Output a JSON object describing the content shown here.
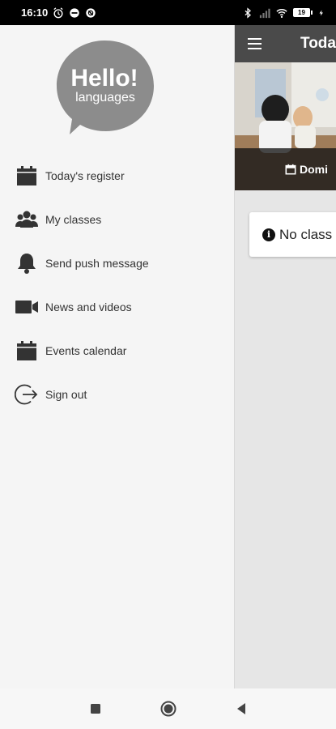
{
  "status_bar": {
    "time": "16:10",
    "battery": "19"
  },
  "drawer": {
    "logo": {
      "line1": "Hello!",
      "line2": "languages"
    },
    "items": [
      {
        "label": "Today's register",
        "icon": "calendar-icon"
      },
      {
        "label": "My classes",
        "icon": "people-icon"
      },
      {
        "label": "Send push message",
        "icon": "bell-icon"
      },
      {
        "label": "News and videos",
        "icon": "video-camera-icon"
      },
      {
        "label": "Events calendar",
        "icon": "calendar-icon"
      },
      {
        "label": "Sign out",
        "icon": "sign-out-icon"
      }
    ]
  },
  "app": {
    "title": "Toda",
    "hero_label": "Domi",
    "notice": "No class"
  },
  "colors": {
    "toolbar": "#4a4a4a",
    "drawer_bg": "#f5f5f5",
    "icon": "#333333",
    "logo_bubble": "#8c8c8c"
  }
}
